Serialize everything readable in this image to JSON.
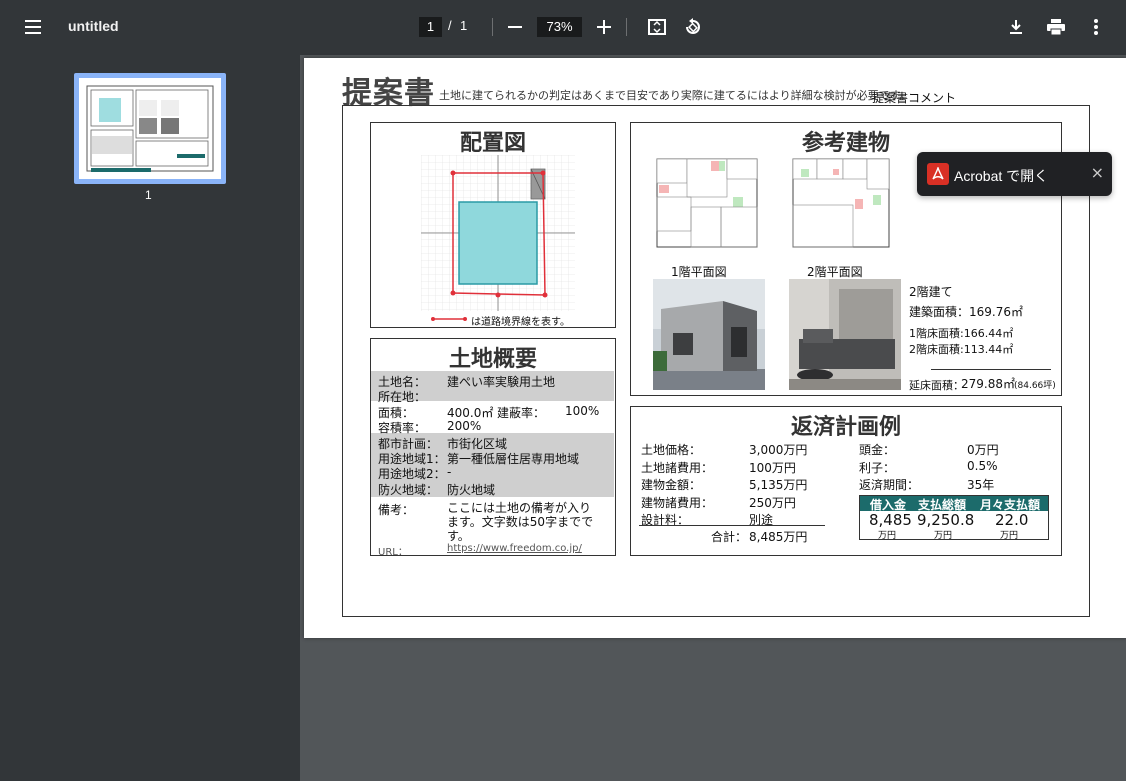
{
  "toolbar": {
    "title": "untitled",
    "current_page": "1",
    "separator": "/",
    "total_pages": "1",
    "zoom": "73%"
  },
  "sidebar": {
    "thumbnail_label": "1"
  },
  "popup": {
    "label": "Acrobat で開く",
    "close": "×"
  },
  "doc": {
    "title": "提案書",
    "note": "土地に建てられるかの判定はあくまで目安であり実際に建てるにはより詳細な検討が必要です。",
    "comment": "提案書コメント",
    "layout_panel": {
      "title": "配置図",
      "legend": "は道路境界線を表す。"
    },
    "building_panel": {
      "title": "参考建物",
      "floor1_label": "1階平面図",
      "floor2_label": "2階平面図",
      "stories": "2階建て",
      "building_area": "建築面積：169.76㎡",
      "floor1_area": "1階床面積:166.44㎡",
      "floor2_area": "2階床面積:113.44㎡",
      "total_area_label": "延床面積：",
      "total_area_value": "279.88㎡",
      "total_area_tsubo": "(84.66坪)"
    },
    "land_panel": {
      "title": "土地概要",
      "rows": [
        {
          "label": "土地名：",
          "value": "建ぺい率実験用土地"
        },
        {
          "label": "所在地：",
          "value": ""
        },
        {
          "label": "面積：",
          "value": "400.0㎡"
        },
        {
          "label": "建蔽率：",
          "value": "100%"
        },
        {
          "label": "容積率：",
          "value": "200%"
        },
        {
          "label": "都市計画：",
          "value": "市街化区域"
        },
        {
          "label": "用途地域1：",
          "value": "第一種低層住居専用地域"
        },
        {
          "label": "用途地域2：",
          "value": "-"
        },
        {
          "label": "防火地域：",
          "value": "防火地域"
        },
        {
          "label": "備考：",
          "value": "ここには土地の備考が入ります。文字数は50字までです。"
        },
        {
          "label": "URL：",
          "value": "https://www.freedom.co.jp/"
        }
      ]
    },
    "repay_panel": {
      "title": "返済計画例",
      "left": [
        {
          "label": "土地価格：",
          "value": "3,000万円"
        },
        {
          "label": "土地諸費用：",
          "value": "100万円"
        },
        {
          "label": "建物金額：",
          "value": "5,135万円"
        },
        {
          "label": "建物諸費用：",
          "value": "250万円"
        },
        {
          "label": "設計料：",
          "value": "別途"
        }
      ],
      "total_label": "合計：",
      "total_value": "8,485万円",
      "right": [
        {
          "label": "頭金：",
          "value": "0万円"
        },
        {
          "label": "利子：",
          "value": "0.5%"
        },
        {
          "label": "返済期間：",
          "value": "35年"
        }
      ],
      "table": {
        "headers": [
          "借入金",
          "支払総額",
          "月々支払額"
        ],
        "values": [
          "8,485",
          "9,250.8",
          "22.0"
        ],
        "units": [
          "万円",
          "万円",
          "万円"
        ]
      }
    }
  },
  "colors": {
    "toolbar_bg": "#323639",
    "viewer_bg": "#525659",
    "thumb_highlight": "#8ab4f8",
    "site_fill": "#8fd8dc",
    "boundary_red": "#e0303a",
    "table_header": "#1c6b6b"
  }
}
